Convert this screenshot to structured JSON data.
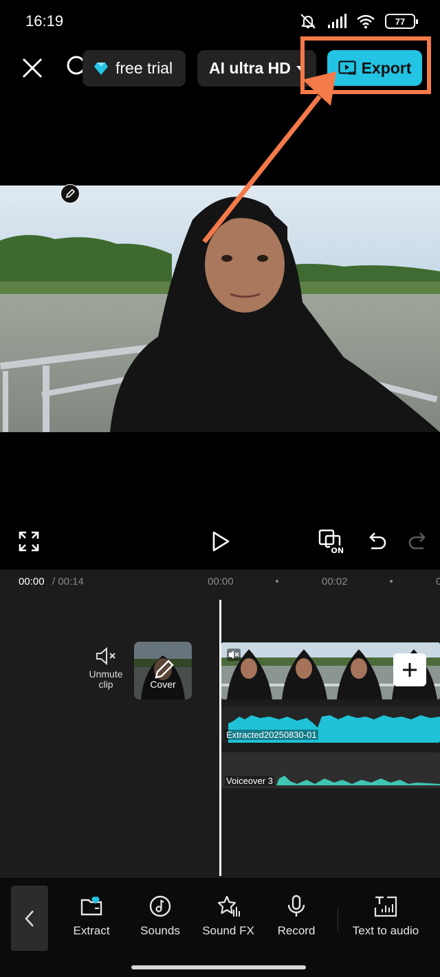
{
  "status_bar": {
    "time": "16:19",
    "battery": "77"
  },
  "top_bar": {
    "trial_label": "free trial",
    "quality_label": "AI ultra HD",
    "export_label": "Export"
  },
  "timeline": {
    "current_time": "00:00",
    "total_time": " / 00:14",
    "ticks": [
      "00:00",
      "00:02",
      "0"
    ],
    "unmute_label": "Unmute clip",
    "cover_label": "Cover",
    "audio_tracks": [
      "Extracted20250830-01",
      "Voiceover 3"
    ]
  },
  "toolbar": {
    "items": [
      {
        "label": "Extract",
        "icon": "folder-icon"
      },
      {
        "label": "Sounds",
        "icon": "music-note-icon"
      },
      {
        "label": "Sound FX",
        "icon": "star-bars-icon"
      },
      {
        "label": "Record",
        "icon": "microphone-icon"
      },
      {
        "label": "Text to audio",
        "icon": "text-audio-icon"
      }
    ]
  },
  "colors": {
    "accent": "#22c3e3",
    "annotation": "#f47a4a",
    "waveform_primary": "#1fc2d6",
    "waveform_secondary": "#3fc5b4"
  }
}
